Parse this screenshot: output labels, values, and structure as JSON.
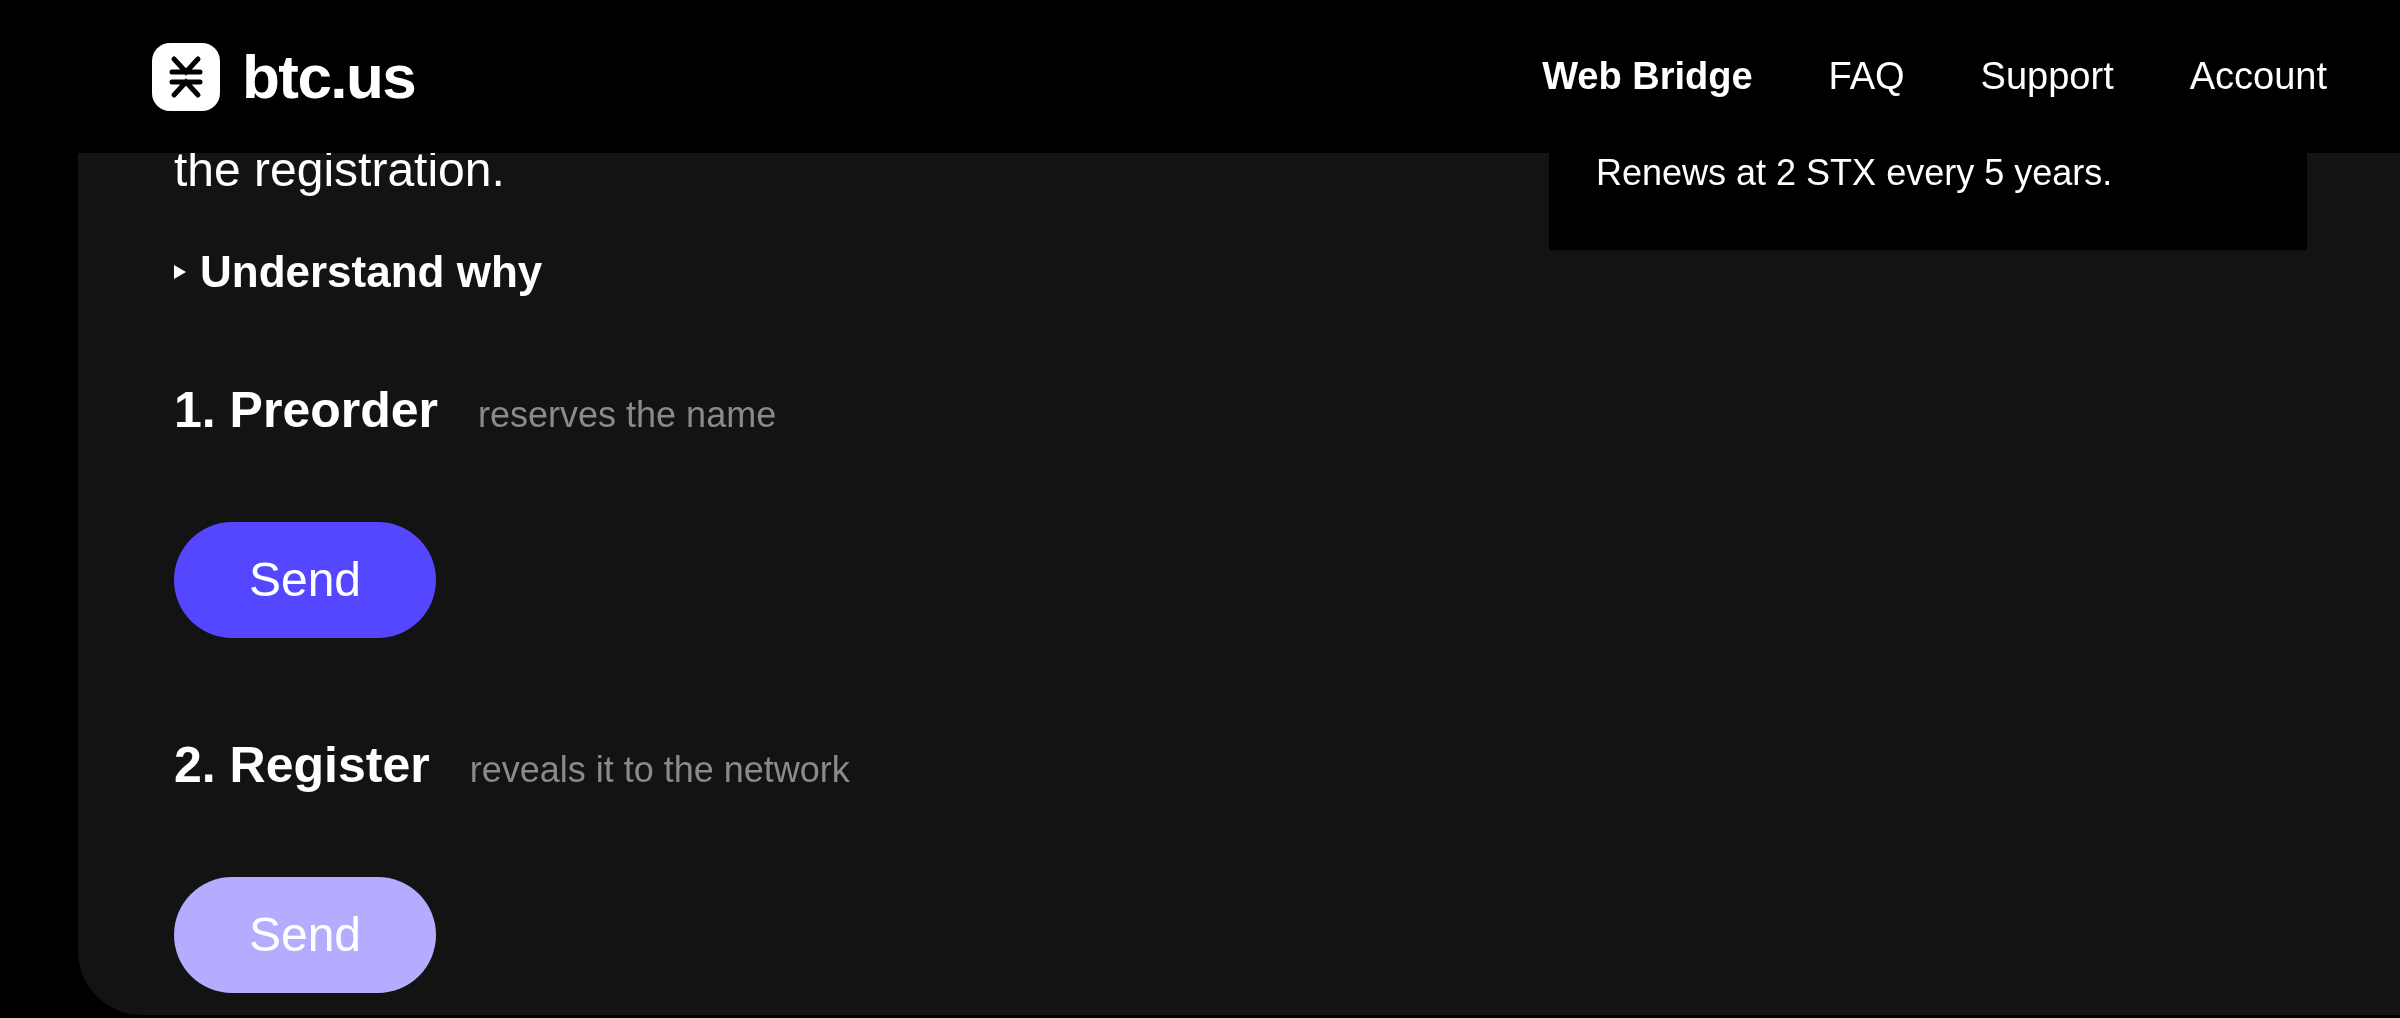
{
  "header": {
    "logo_text": "btc.us",
    "nav": [
      {
        "label": "Web Bridge",
        "selected": true
      },
      {
        "label": "FAQ",
        "selected": false
      },
      {
        "label": "Support",
        "selected": false
      },
      {
        "label": "Account",
        "selected": false
      }
    ]
  },
  "intro_text": "the registration.",
  "disclosure": {
    "label": "Understand why",
    "expanded": false
  },
  "steps": [
    {
      "title": "1. Preorder",
      "hint": "reserves the name",
      "button": {
        "label": "Send",
        "disabled": false
      }
    },
    {
      "title": "2. Register",
      "hint": "reveals it to the network",
      "button": {
        "label": "Send",
        "disabled": true
      }
    }
  ],
  "summary": {
    "text": "Renews at 2 STX every 5 years."
  }
}
